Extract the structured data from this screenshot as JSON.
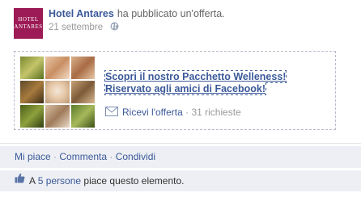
{
  "post": {
    "avatar": {
      "line1": "HOTEL",
      "line2": "ANTARES"
    },
    "page_name": "Hotel Antares",
    "action_text": "ha pubblicato un'offerta.",
    "date": "21 settembre",
    "privacy_icon": "globe-icon"
  },
  "offer": {
    "title": "Scopri il nostro Pacchetto Welleness! Riservato agli amici di Facebook!",
    "claim_label": "Ricevi l'offerta",
    "claim_separator": " · ",
    "claim_count": "31 richieste",
    "claim_icon": "envelope-icon"
  },
  "actions": {
    "like": "Mi piace",
    "comment": "Commenta",
    "share": "Condividi",
    "sep": " · "
  },
  "likes": {
    "prefix": "A",
    "link": "5 persone",
    "suffix": "piace questo elemento.",
    "icon": "thumbs-up-icon"
  },
  "colors": {
    "link": "#3b5998",
    "avatar_bg": "#9c1a55",
    "bar_bg": "#edeff4"
  }
}
